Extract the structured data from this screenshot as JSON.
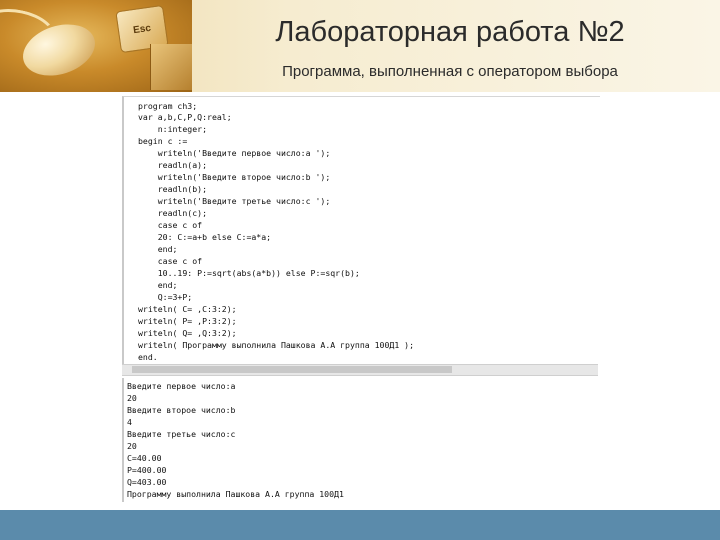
{
  "slide": {
    "title": "Лабораторная работа №2",
    "subtitle": "Программа, выполненная с оператором выбора",
    "header_photo": {
      "key_label": "Esc"
    }
  },
  "code_lines": [
    "program ch3;",
    "var a,b,C,P,Q:real;",
    "    n:integer;",
    "begin c :=",
    "    writeln('Введите первое число:a ');",
    "    readln(a);",
    "    writeln('Введите второе число:b ');",
    "    readln(b);",
    "    writeln('Введите третье число:c ');",
    "    readln(c);",
    "    case c of",
    "    20: C:=a+b else C:=a*a;",
    "    end;",
    "    case c of",
    "    10..19: P:=sqrt(abs(a*b)) else P:=sqr(b);",
    "    end;",
    "    Q:=3+P;",
    "writeln( C= ,C:3:2);",
    "writeln( P= ,P:3:2);",
    "writeln( Q= ,Q:3:2);",
    "writeln( Программу выполнила Пашкова А.А группа 100Д1 );",
    "end."
  ],
  "output_lines": [
    "Введите первое число:a",
    "20",
    "Введите второе число:b",
    "4",
    "Введите третье число:c",
    "20",
    "C=40.00",
    "P=400.00",
    "Q=403.00",
    "Программу выполнила Пашкова А.А группа 100Д1"
  ],
  "colors": {
    "footer": "#5b8bab",
    "header_bg": "#f6ecd0"
  }
}
